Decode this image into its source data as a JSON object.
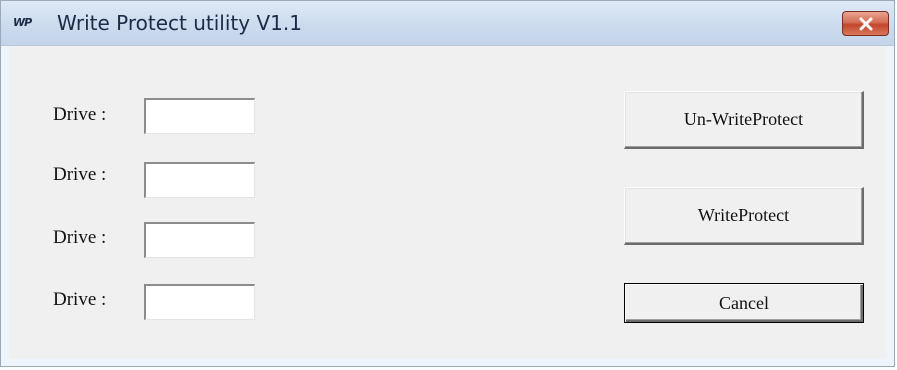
{
  "window": {
    "title": "Write Protect utility V1.1",
    "icon_text": "WP",
    "icon": "write-protect-app-icon",
    "close_icon": "close-icon"
  },
  "drives": [
    {
      "label": "Drive :",
      "value": ""
    },
    {
      "label": "Drive :",
      "value": ""
    },
    {
      "label": "Drive :",
      "value": ""
    },
    {
      "label": "Drive :",
      "value": ""
    }
  ],
  "buttons": {
    "unwriteprotect": "Un-WriteProtect",
    "writeprotect": "WriteProtect",
    "cancel": "Cancel"
  },
  "colors": {
    "title_bar": "#c9d9ed",
    "close_button": "#c7503a",
    "dialog_face": "#f0f0f0"
  }
}
